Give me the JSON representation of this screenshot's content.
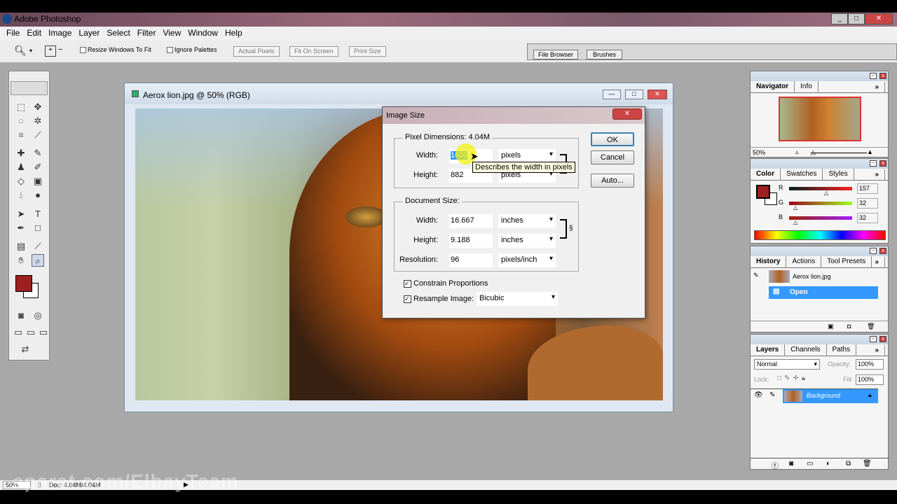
{
  "app": {
    "title": "Adobe Photoshop"
  },
  "menu": [
    "File",
    "Edit",
    "Image",
    "Layer",
    "Select",
    "Filter",
    "View",
    "Window",
    "Help"
  ],
  "options": {
    "resize_windows": "Resize Windows To Fit",
    "ignore_palettes": "Ignore Palettes",
    "actual_pixels": "Actual Pixels",
    "fit_on_screen": "Fit On Screen",
    "print_size": "Print Size",
    "file_browser": "File Browser",
    "brushes": "Brushes"
  },
  "document": {
    "title": "Aerox lion.jpg @ 50% (RGB)"
  },
  "dialog": {
    "title": "Image Size",
    "pixel_dimensions": "Pixel Dimensions:",
    "pixel_size": "4.04M",
    "width_label": "Width:",
    "height_label": "Height:",
    "px_width": "1600",
    "px_height": "882",
    "px_unit": "pixels",
    "tooltip": "Describes the width in pixels",
    "document_size": "Document Size:",
    "doc_width": "16.667",
    "doc_height": "9.188",
    "doc_unit": "inches",
    "resolution_label": "Resolution:",
    "resolution": "96",
    "resolution_unit": "pixels/inch",
    "constrain": "Constrain Proportions",
    "constrain_checked": true,
    "resample": "Resample Image:",
    "resample_checked": true,
    "resample_method": "Bicubic",
    "ok": "OK",
    "cancel": "Cancel",
    "auto": "Auto..."
  },
  "navigator": {
    "tabs": [
      "Navigator",
      "Info"
    ],
    "zoom": "50%"
  },
  "color": {
    "tabs": [
      "Color",
      "Swatches",
      "Styles"
    ],
    "r_label": "R",
    "g_label": "G",
    "b_label": "B",
    "r": "157",
    "g": "32",
    "b": "32",
    "foreground": "#9d2020"
  },
  "history": {
    "tabs": [
      "History",
      "Actions",
      "Tool Presets"
    ],
    "snapshot": "Aerox lion.jpg",
    "state": "Open"
  },
  "layers": {
    "tabs": [
      "Layers",
      "Channels",
      "Paths"
    ],
    "blend_mode": "Normal",
    "opacity_label": "Opacity:",
    "opacity": "100%",
    "lock_label": "Lock:",
    "fill_label": "Fill:",
    "fill": "100%",
    "layer_name": "Background"
  },
  "status": {
    "zoom": "50%",
    "doc": "Doc: 4.04M/4.04M"
  },
  "watermark": "aparat.com/ElbayTeam",
  "colors": {
    "selection": "#3399ff",
    "accent": "#0a64d8"
  }
}
